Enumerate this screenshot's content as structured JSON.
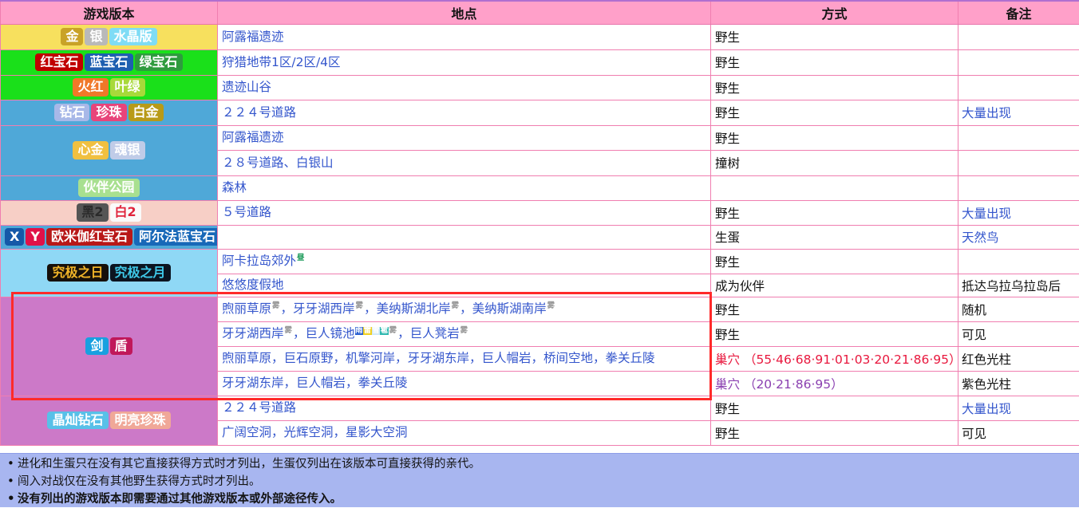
{
  "table": {
    "headers": [
      "游戏版本",
      "地点",
      "方式",
      "备注"
    ],
    "rows": [
      {
        "version_badges": [
          {
            "text": "金",
            "bg": "#c9a227",
            "fg": "#ffffff"
          },
          {
            "text": "银",
            "bg": "#b9b9b9",
            "fg": "#ffffff"
          },
          {
            "text": "水晶版",
            "bg": "#7fdcf5",
            "fg": "#ffffff"
          }
        ],
        "version_bg": "#f7e05e",
        "location": "阿露福遗迹",
        "method": "野生",
        "note": ""
      },
      {
        "version_badges": [
          {
            "text": "红宝石",
            "bg": "#c00000",
            "fg": "#ffffff"
          },
          {
            "text": "蓝宝石",
            "bg": "#1e5fb0",
            "fg": "#ffffff"
          },
          {
            "text": "绿宝石",
            "bg": "#2e9b3e",
            "fg": "#ffffff"
          }
        ],
        "version_bg": "#1ae01a",
        "location": "狩猎地带1区/2区/4区",
        "method": "野生",
        "note": ""
      },
      {
        "version_badges": [
          {
            "text": "火红",
            "bg": "#f07828",
            "fg": "#ffffff"
          },
          {
            "text": "叶绿",
            "bg": "#a8d93a",
            "fg": "#ffffff"
          }
        ],
        "version_bg": "#1ae01a",
        "location": "遗迹山谷",
        "method": "野生",
        "note": ""
      },
      {
        "version_badges": [
          {
            "text": "钻石",
            "bg": "#a8b8e8",
            "fg": "#ffffff"
          },
          {
            "text": "珍珠",
            "bg": "#e8447a",
            "fg": "#ffffff"
          },
          {
            "text": "白金",
            "bg": "#b89a18",
            "fg": "#ffffff"
          }
        ],
        "version_bg": "#4fa8d8",
        "location": "２２４号道路",
        "method": "野生",
        "note": "大量出现",
        "note_blue": true
      },
      {
        "version_badges": [
          {
            "text": "心金",
            "bg": "#f0c040",
            "fg": "#ffffff"
          },
          {
            "text": "魂银",
            "bg": "#c0cce8",
            "fg": "#ffffff"
          }
        ],
        "version_bg": "#4fa8d8",
        "version_rowspan": 2,
        "location": "阿露福遗迹",
        "method": "野生",
        "note": ""
      },
      {
        "version_continued": true,
        "location": "２８号道路、白银山",
        "method": "撞树",
        "note": ""
      },
      {
        "version_badges": [
          {
            "text": "伙伴公园",
            "bg": "#a8e090",
            "fg": "#ffffff"
          }
        ],
        "version_bg": "#4fa8d8",
        "location": "森林",
        "method": "",
        "note": ""
      },
      {
        "version_badges": [
          {
            "text": "黑2",
            "bg": "#555555",
            "fg": "#2a2a2a"
          },
          {
            "text": "白2",
            "bg": "#fafafa",
            "fg": "#e0243c"
          }
        ],
        "version_bg": "#f7cfc6",
        "location": "５号道路",
        "method": "野生",
        "note": "大量出现",
        "note_blue": true
      },
      {
        "version_badges": [
          {
            "text": "X",
            "bg": "#1558a8",
            "fg": "#ffffff"
          },
          {
            "text": "Y",
            "bg": "#e01048",
            "fg": "#ffffff"
          },
          {
            "text": "欧米伽红宝石",
            "bg": "#b81818",
            "fg": "#ffffff"
          },
          {
            "text": "阿尔法蓝宝石",
            "bg": "#1868b8",
            "fg": "#ffffff"
          }
        ],
        "version_bg": "#4fa8d8",
        "location": "",
        "method": "生蛋",
        "note": "天然鸟",
        "note_blue": true
      },
      {
        "version_badges": [
          {
            "text": "究极之日",
            "bg": "#16100a",
            "fg": "#f0b428"
          },
          {
            "text": "究极之月",
            "bg": "#0c1420",
            "fg": "#3fc8e8"
          }
        ],
        "version_bg": "#8fd8f5",
        "version_rowspan": 2,
        "location": "阿卡拉岛郊外",
        "location_sup": "昼",
        "location_sup_kind": "day",
        "method": "野生",
        "note": ""
      },
      {
        "version_continued": true,
        "location": "悠悠度假地",
        "method": "成为伙伴",
        "note": "抵达乌拉乌拉岛后"
      },
      {
        "version_badges": [
          {
            "text": "剑",
            "bg": "#18a0e0",
            "fg": "#ffffff"
          },
          {
            "text": "盾",
            "bg": "#c0185a",
            "fg": "#ffffff"
          }
        ],
        "version_bg": "#cc79c8",
        "version_rowspan": 4,
        "location_parts": [
          {
            "t": "煦丽草原",
            "sup": "雾"
          },
          {
            "t": "，牙牙湖西岸",
            "sup": "雾"
          },
          {
            "t": "，美纳斯湖北岸",
            "sup": "雾"
          },
          {
            "t": "，美纳斯湖南岸",
            "sup": "雾"
          }
        ],
        "method": "野生",
        "note": "随机"
      },
      {
        "version_continued": true,
        "location_parts": [
          {
            "t": "牙牙湖西岸",
            "sup": "雾"
          },
          {
            "t": "，巨人镜池",
            "weather": [
              "雨",
              "雷",
              "雪",
              "雹"
            ],
            "sup": "雾"
          },
          {
            "t": "，巨人凳岩",
            "sup": "雾"
          }
        ],
        "method": "野生",
        "note": "可见"
      },
      {
        "version_continued": true,
        "location": "煦丽草原，巨石原野，机擎河岸，牙牙湖东岸，巨人帽岩，桥间空地，拳关丘陵",
        "method_nest": "巢穴",
        "method_nest_nums": "（55·46·68·91·01·03·20·21·86·95）",
        "method_nest_color": "red",
        "note": "红色光柱"
      },
      {
        "version_continued": true,
        "location": "牙牙湖东岸，巨人帽岩，拳关丘陵",
        "method_nest": "巢穴",
        "method_nest_nums": "（20·21·86·95）",
        "method_nest_color": "purple",
        "note": "紫色光柱"
      },
      {
        "version_badges": [
          {
            "text": "晶灿钻石",
            "bg": "#58c0e8",
            "fg": "#ffffff"
          },
          {
            "text": "明亮珍珠",
            "bg": "#f0a898",
            "fg": "#ffffff"
          }
        ],
        "version_bg": "#cc79c8",
        "version_rowspan": 2,
        "location": "２２４号道路",
        "method": "野生",
        "note": "大量出现",
        "note_blue": true
      },
      {
        "version_continued": true,
        "location": "广阔空洞，光辉空洞，星影大空洞",
        "method": "野生",
        "note": "可见"
      }
    ]
  },
  "highlight": {
    "color": "#ff2a2a"
  },
  "footer": {
    "notes": [
      {
        "text": "进化和生蛋只在没有其它直接获得方式时才列出，生蛋仅列出在该版本可直接获得的亲代。",
        "bold": false
      },
      {
        "text": "闯入对战仅在没有其他野生获得方式时才列出。",
        "bold": false
      },
      {
        "text": "没有列出的游戏版本即需要通过其他游戏版本或外部途径传入。",
        "bold": true
      }
    ]
  },
  "weather_colors": {
    "雨": {
      "bg": "#2a5fd0",
      "fg": "#ffffff"
    },
    "雷": {
      "bg": "#f0d020",
      "fg": "#ffffff"
    },
    "雪": {
      "bg": "#cfe8f8",
      "fg": "#ffffff"
    },
    "雹": {
      "bg": "#2fb8b0",
      "fg": "#ffffff"
    }
  }
}
